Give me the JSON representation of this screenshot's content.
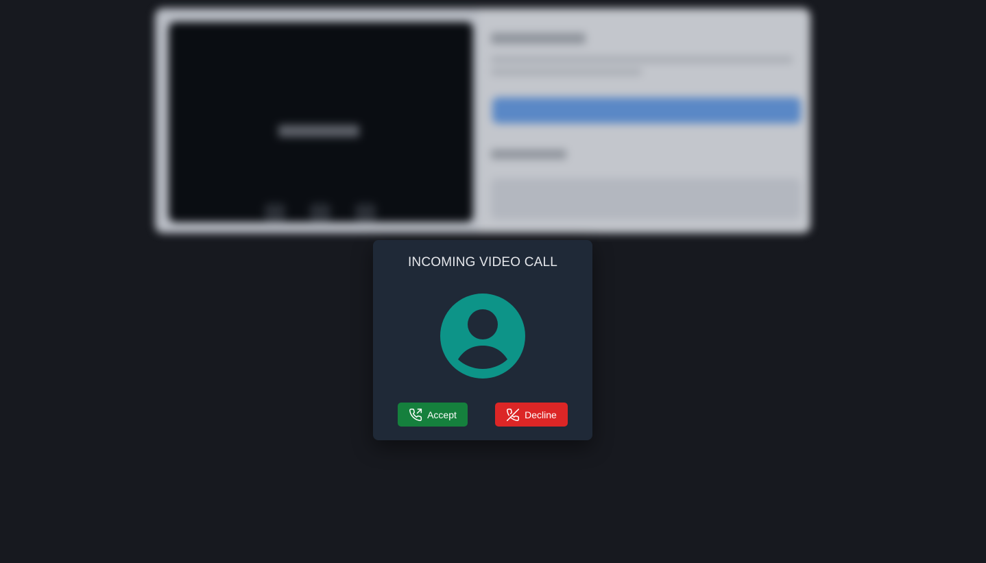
{
  "modal": {
    "title": "INCOMING VIDEO CALL",
    "avatar_icon": "user-avatar-icon",
    "avatar_color": "#0d9488",
    "accept": {
      "label": "Accept",
      "icon": "phone-outgoing-icon",
      "color": "#15803d"
    },
    "decline": {
      "label": "Decline",
      "icon": "phone-off-icon",
      "color": "#dc2626"
    }
  },
  "background": {
    "state": "blurred",
    "color": "#17191f"
  }
}
